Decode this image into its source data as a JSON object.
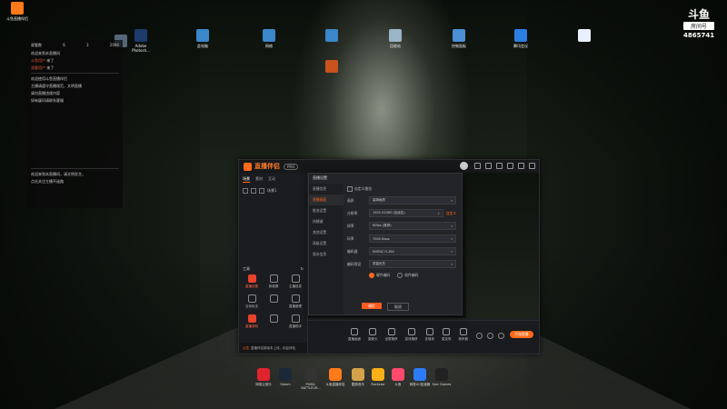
{
  "desktop": {
    "icons": [
      {
        "label": "斗鱼直播伴侣",
        "color": "#ff7a1a",
        "icon": "douyu-companion-icon"
      },
      {
        "label": "",
        "color": "#556677",
        "icon": "folder-icon"
      },
      {
        "label": "Adobe Photosh...",
        "color": "#1c3a6b",
        "icon": "photoshop-icon"
      },
      {
        "label": "此电脑",
        "color": "#3a87c9",
        "icon": "computer-icon"
      },
      {
        "label": "网络",
        "color": "#3a87c9",
        "icon": "network-icon"
      },
      {
        "label": "",
        "color": "#3a87c9",
        "icon": "edge-icon"
      },
      {
        "label": "回收站",
        "color": "#9ab4c8",
        "icon": "recycle-bin-icon"
      },
      {
        "label": "控制面板",
        "color": "#4a8fd4",
        "icon": "control-panel-icon"
      },
      {
        "label": "腾讯会议",
        "color": "#2c7fe0",
        "icon": "tencent-meeting-icon"
      },
      {
        "label": "",
        "color": "#e8f0ff",
        "icon": "app-icon"
      },
      {
        "label": "",
        "color": "#c9521e",
        "icon": "game-icon"
      }
    ]
  },
  "chat_panel": {
    "header": [
      "观看数",
      "6",
      "3",
      "2094"
    ],
    "lines": [
      {
        "text": "欢迎来到本直播间",
        "highlight": false
      },
      {
        "text": "斗鱼用户",
        "suffix": "来了",
        "highlight": true
      },
      {
        "text": "游客用户",
        "suffix": "来了",
        "highlight": true
      }
    ],
    "system": [
      "欢迎使用斗鱼直播伴侣",
      "主播请遵守直播规范，文明直播",
      "请勿直播违规内容",
      "如有疑问请联系客服"
    ],
    "footer": [
      "欢迎来到本直播间，请文明发言，",
      "点击关注主播不迷路"
    ]
  },
  "watermark": {
    "logo": "斗鱼",
    "room_label": "房间号",
    "room_number": "4865741"
  },
  "app": {
    "brand": "直播伴侣",
    "version": "PRO",
    "left_tabs": [
      "场景",
      "素材",
      "互动"
    ],
    "scene_label": "场景1",
    "tools_title": "工具",
    "tools": [
      {
        "label": "直播设置",
        "active": true,
        "icon": "camera-icon"
      },
      {
        "label": "新增源",
        "active": false,
        "icon": "add-source-icon"
      },
      {
        "label": "主播信息",
        "active": false,
        "icon": "user-icon"
      },
      {
        "label": "互动玩法",
        "active": false,
        "icon": "game-icon"
      },
      {
        "label": "",
        "active": false,
        "icon": "chart-icon"
      },
      {
        "label": "直播管理",
        "active": false,
        "icon": "manage-icon"
      },
      {
        "label": "直播录制",
        "active": true,
        "icon": "record-icon"
      },
      {
        "label": "",
        "active": false,
        "icon": "gift-icon"
      },
      {
        "label": "直播助手",
        "active": false,
        "icon": "calendar-icon"
      }
    ],
    "notice_tag": "公告",
    "notice_text": "直播伴侣新版本上线，欢迎体验",
    "bottom_items": [
      {
        "label": "直播画面",
        "icon": "screen-icon"
      },
      {
        "label": "摄像头",
        "icon": "webcam-icon"
      },
      {
        "label": "全屏捕获",
        "icon": "capture-icon"
      },
      {
        "label": "游戏捕获",
        "icon": "game-capture-icon"
      },
      {
        "label": "多媒体",
        "icon": "media-icon"
      },
      {
        "label": "麦克风",
        "icon": "mic-icon"
      },
      {
        "label": "扬声器",
        "icon": "speaker-icon"
      }
    ],
    "go_live": "开始直播"
  },
  "settings": {
    "title": "直播设置",
    "nav": [
      "直播信息",
      "直播画面",
      "推流设置",
      "快捷键",
      "其他设置",
      "高级设置",
      "版本信息"
    ],
    "active_nav": 1,
    "checkbox_label": "自定义推流",
    "rows": [
      {
        "label": "画质",
        "value": "高清画质",
        "link": ""
      },
      {
        "label": "分辨率",
        "value": "1920 X1080 (自适应)",
        "link": "自定义"
      },
      {
        "label": "帧率",
        "value": "60fps (推荐)",
        "link": ""
      },
      {
        "label": "码率",
        "value": "7000 Kbps",
        "link": ""
      },
      {
        "label": "编码器",
        "value": "NVENC H.264",
        "link": ""
      },
      {
        "label": "编码预设",
        "value": "质量优先",
        "link": ""
      }
    ],
    "radio_a": "硬件编码",
    "radio_b": "软件编码",
    "ok": "确定",
    "cancel": "取消"
  },
  "taskbar": [
    {
      "label": "网易云音乐",
      "color": "#e0242d",
      "icon": "netease-music-icon"
    },
    {
      "label": "Steam",
      "color": "#1b2838",
      "icon": "steam-icon"
    },
    {
      "label": "PUBG: BATTLEGR...",
      "color": "#333",
      "icon": "pubg-icon"
    },
    {
      "label": "斗鱼直播伴侣",
      "color": "#ff7a1a",
      "icon": "douyu-icon"
    },
    {
      "label": "酷狗音乐",
      "color": "#d5a24a",
      "icon": "kugou-icon"
    },
    {
      "label": "Rockstar",
      "color": "#fcaf17",
      "icon": "rockstar-icon"
    },
    {
      "label": "斗鱼",
      "color": "#ff4a6e",
      "icon": "douyu-app-icon"
    },
    {
      "label": "网易UU加速器",
      "color": "#2d7cf6",
      "icon": "uu-icon"
    },
    {
      "label": "Epic Games",
      "color": "#222",
      "icon": "epic-icon"
    }
  ]
}
